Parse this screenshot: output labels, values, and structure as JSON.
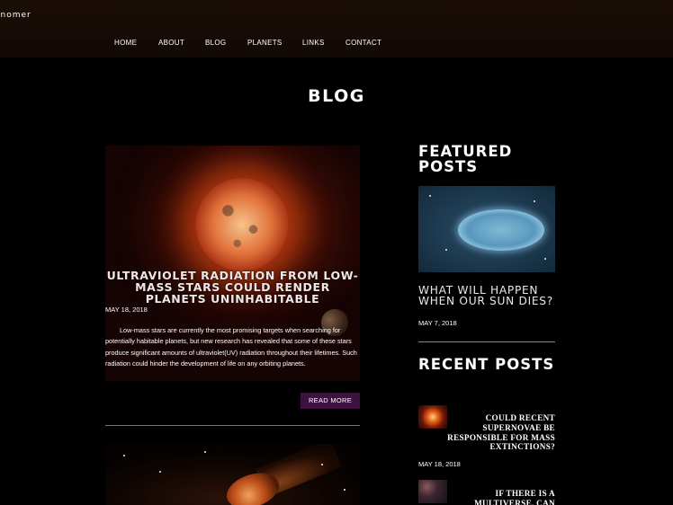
{
  "header": {
    "logo_text": "onomer",
    "nav": [
      "HOME",
      "ABOUT",
      "BLOG",
      "PLANETS",
      "LINKS",
      "CONTACT"
    ]
  },
  "page": {
    "title": "BLOG"
  },
  "main_post": {
    "title": "ULTRAVIOLET RADIATION FROM LOW-MASS STARS COULD RENDER PLANETS UNINHABITABLE",
    "date": "MAY 18, 2018",
    "excerpt": "Low-mass stars are currently the most promising targets when searching for potentially habitable planets, but new research has revealed that some of these stars produce significant amounts of ultraviolet(UV) radiation throughout their lifetimes. Such radiation could hinder the development of life on any orbiting planets.",
    "read_more_label": "READ MORE"
  },
  "sidebar": {
    "featured_heading": "FEATURED POSTS",
    "featured_post": {
      "title": "WHAT WILL HAPPEN WHEN OUR SUN DIES?",
      "date": "MAY 7, 2018"
    },
    "recent_heading": "RECENT POSTS",
    "recent_posts": [
      {
        "title": "COULD RECENT SUPERNOVAE BE RESPONSIBLE FOR MASS EXTINCTIONS?",
        "date": "MAY 18, 2018"
      },
      {
        "title": "IF THERE IS A MULTIVERSE, CAN"
      }
    ]
  },
  "colors": {
    "header_bg": "#170c06",
    "read_more_bg": "#3d1240",
    "background": "#000000"
  }
}
